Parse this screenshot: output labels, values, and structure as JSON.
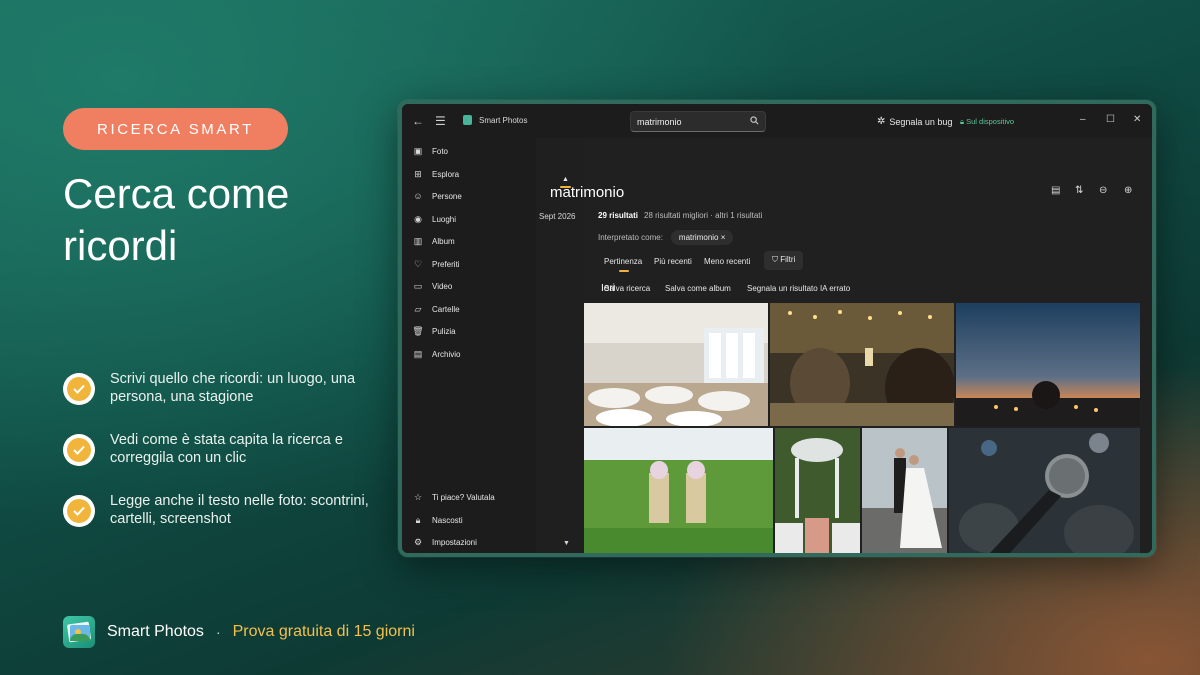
{
  "promo": {
    "badge": "RICERCA SMART",
    "headline": "Cerca come ricordi",
    "features": [
      "Scrivi quello che ricordi: un luogo, una persona, una stagione",
      "Vedi come è stata capita la ricerca e correggila con un clic",
      "Legge anche il testo nelle foto: scontrini, cartelli, screenshot"
    ],
    "brand": "Smart Photos",
    "separator": "·",
    "trial": "Prova gratuita di 15 giorni"
  },
  "app": {
    "title": "Smart Photos",
    "search": {
      "value": "matrimonio",
      "placeholder": ""
    },
    "bug_label": "Segnala un bug",
    "on_device": "Sul dispositivo",
    "nav": [
      {
        "label": "Foto",
        "icon": "photo-icon"
      },
      {
        "label": "Esplora",
        "icon": "explore-icon"
      },
      {
        "label": "Persone",
        "icon": "people-icon"
      },
      {
        "label": "Luoghi",
        "icon": "places-icon"
      },
      {
        "label": "Album",
        "icon": "album-icon"
      },
      {
        "label": "Preferiti",
        "icon": "heart-icon"
      },
      {
        "label": "Video",
        "icon": "video-icon"
      },
      {
        "label": "Cartelle",
        "icon": "folder-icon"
      },
      {
        "label": "Pulizia",
        "icon": "trash-icon"
      },
      {
        "label": "Archivio",
        "icon": "archive-icon"
      }
    ],
    "nav_bottom": [
      {
        "label": "Ti piace? Valutala",
        "icon": "star-icon"
      },
      {
        "label": "Nascosti",
        "icon": "lock-icon"
      },
      {
        "label": "Impostazioni",
        "icon": "gear-icon"
      }
    ],
    "timeline": {
      "date": "Sept 2026"
    },
    "query": "matrimonio",
    "counts": {
      "main": "29 risultati",
      "detail": "28 risultati migliori · altri 1 risultati"
    },
    "interpreted": {
      "label": "Interpretato come:",
      "chip": "matrimonio",
      "chip_close": "×"
    },
    "sort": {
      "relevance": "Pertinenza",
      "newest": "Più recenti",
      "oldest": "Meno recenti",
      "filters": "Filtri"
    },
    "actions": {
      "save_search": "Salva ricerca",
      "save_album": "Salva come album",
      "report_ai": "Segnala un risultato IA errato"
    },
    "section": "Ieri",
    "colors": {
      "accent": "#f0b23a",
      "badge": "#f07f62",
      "on_device": "#5bc896",
      "trial": "#f3c04c"
    }
  }
}
